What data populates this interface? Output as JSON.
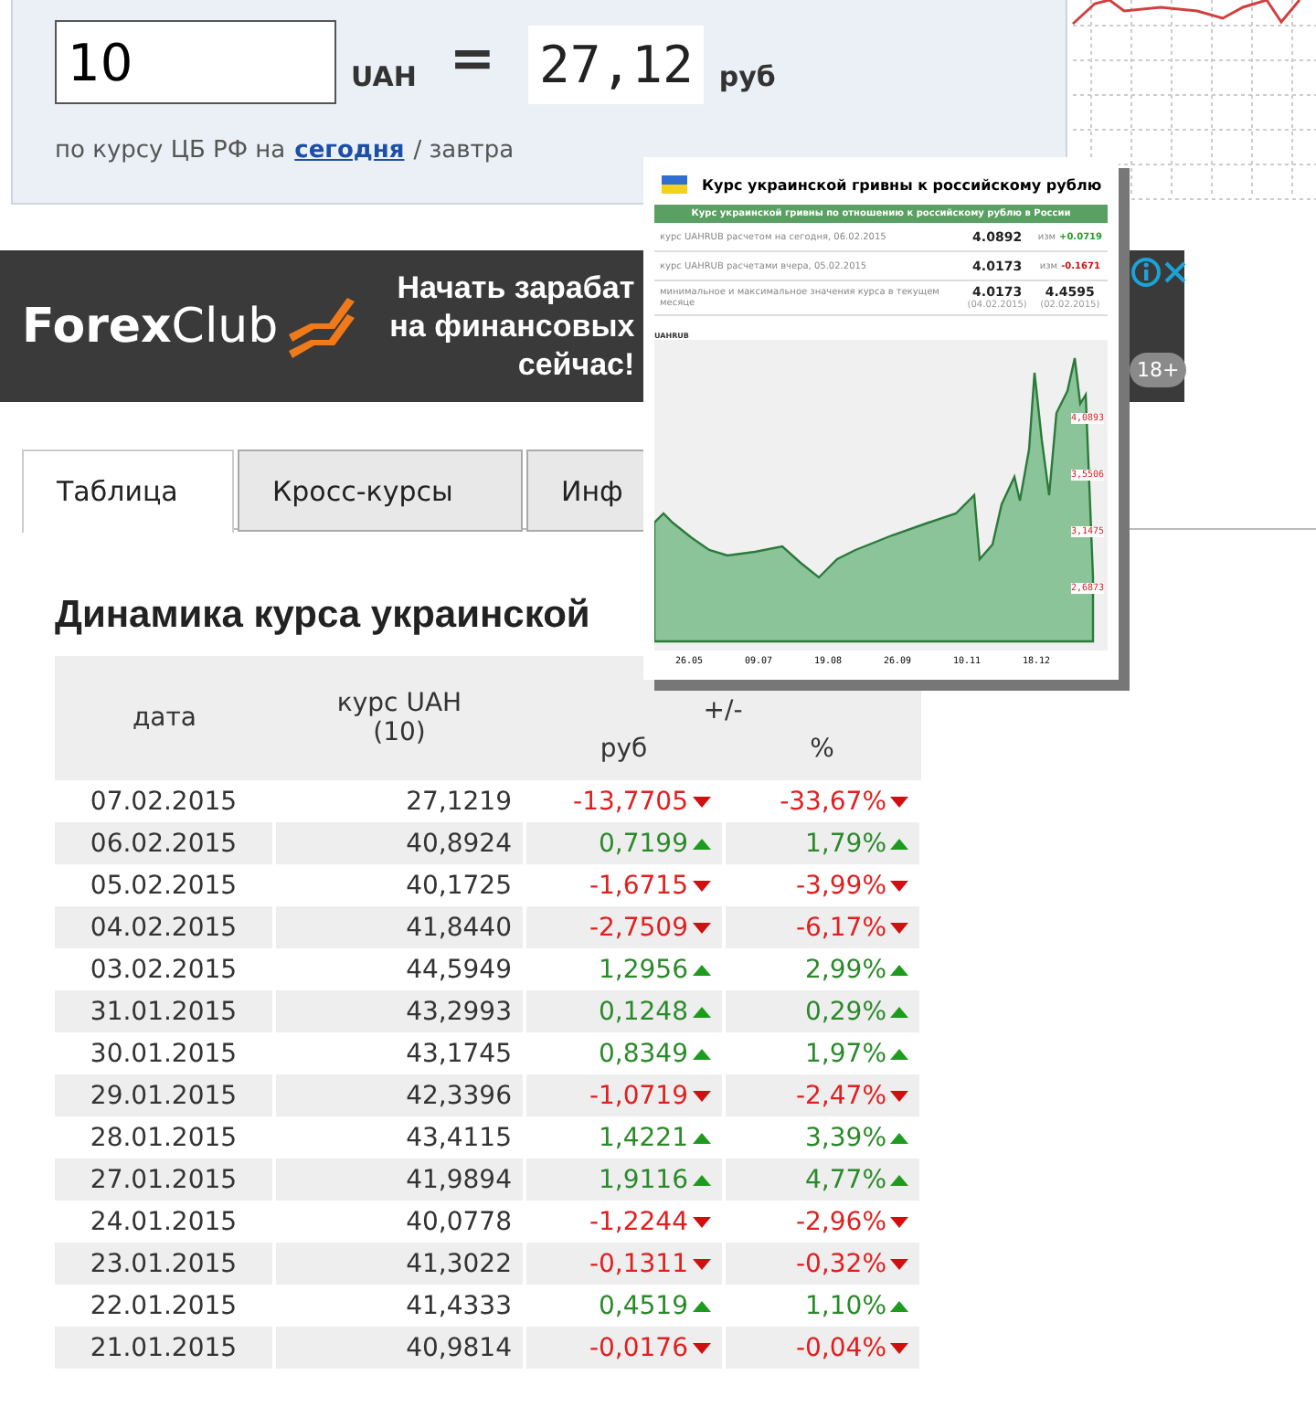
{
  "converter": {
    "amount": "10",
    "from": "UAH",
    "equals": "=",
    "result": "27,12",
    "to": "руб",
    "note_before": "по курсу ЦБ РФ на",
    "link": "сегодня",
    "note_after": "/ завтра"
  },
  "ad": {
    "brand_bold": "Forex",
    "brand": "Club",
    "lines": [
      "Начать зарабат",
      "на финансовых",
      "сейчас!"
    ],
    "age": "18+"
  },
  "tabs": [
    {
      "label": "Таблица",
      "selected": true
    },
    {
      "label": "Кросс-курсы",
      "selected": false
    },
    {
      "label": "Инф",
      "selected": false
    }
  ],
  "heading": "Динамика курса украинской",
  "table": {
    "columns": {
      "date": "дата",
      "rate": "курс UAH (10)",
      "change": "+/-",
      "rub": "руб",
      "pct": "%"
    },
    "rows": [
      {
        "date": "07.02.2015",
        "rate": "27,1219",
        "rub": "-13,7705",
        "pct": "-33,67%",
        "rising": false
      },
      {
        "date": "06.02.2015",
        "rate": "40,8924",
        "rub": "0,7199",
        "pct": "1,79%",
        "rising": true
      },
      {
        "date": "05.02.2015",
        "rate": "40,1725",
        "rub": "-1,6715",
        "pct": "-3,99%",
        "rising": false
      },
      {
        "date": "04.02.2015",
        "rate": "41,8440",
        "rub": "-2,7509",
        "pct": "-6,17%",
        "rising": false
      },
      {
        "date": "03.02.2015",
        "rate": "44,5949",
        "rub": "1,2956",
        "pct": "2,99%",
        "rising": true
      },
      {
        "date": "31.01.2015",
        "rate": "43,2993",
        "rub": "0,1248",
        "pct": "0,29%",
        "rising": true
      },
      {
        "date": "30.01.2015",
        "rate": "43,1745",
        "rub": "0,8349",
        "pct": "1,97%",
        "rising": true
      },
      {
        "date": "29.01.2015",
        "rate": "42,3396",
        "rub": "-1,0719",
        "pct": "-2,47%",
        "rising": false
      },
      {
        "date": "28.01.2015",
        "rate": "43,4115",
        "rub": "1,4221",
        "pct": "3,39%",
        "rising": true
      },
      {
        "date": "27.01.2015",
        "rate": "41,9894",
        "rub": "1,9116",
        "pct": "4,77%",
        "rising": true
      },
      {
        "date": "24.01.2015",
        "rate": "40,0778",
        "rub": "-1,2244",
        "pct": "-2,96%",
        "rising": false
      },
      {
        "date": "23.01.2015",
        "rate": "41,3022",
        "rub": "-0,1311",
        "pct": "-0,32%",
        "rising": false
      },
      {
        "date": "22.01.2015",
        "rate": "41,4333",
        "rub": "0,4519",
        "pct": "1,10%",
        "rising": true
      },
      {
        "date": "21.01.2015",
        "rate": "40,9814",
        "rub": "-0,0176",
        "pct": "-0,04%",
        "rising": false
      }
    ]
  },
  "popup": {
    "title": "Курс украинской гривны к российскому рублю",
    "subtitle": "Курс украинской гривны по отношению к российскому рублю в России",
    "rows": [
      {
        "kind": "change",
        "label": "курс UAHRUB расчетом на сегодня, 06.02.2015",
        "value": "4.0892",
        "change_label": "изм",
        "change": "+0.0719",
        "rising": true
      },
      {
        "kind": "change",
        "label": "курс UAHRUB расчетами вчера, 05.02.2015",
        "value": "4.0173",
        "change_label": "изм",
        "change": "-0.1671",
        "rising": false
      },
      {
        "kind": "range",
        "label": "минимальное и максимальное значения курса в текущем месяце",
        "value": "4.0173",
        "value_date": "(04.02.2015)",
        "max": "4.4595",
        "max_date": "(02.02.2015)"
      }
    ],
    "chart": {
      "label": "UAHRUB",
      "y_labels": [
        "4,0893",
        "3,5506",
        "3,1475",
        "2,6873"
      ],
      "x_labels": [
        "26.05",
        "09.07",
        "19.08",
        "26.09",
        "10.11",
        "18.12"
      ]
    }
  }
}
